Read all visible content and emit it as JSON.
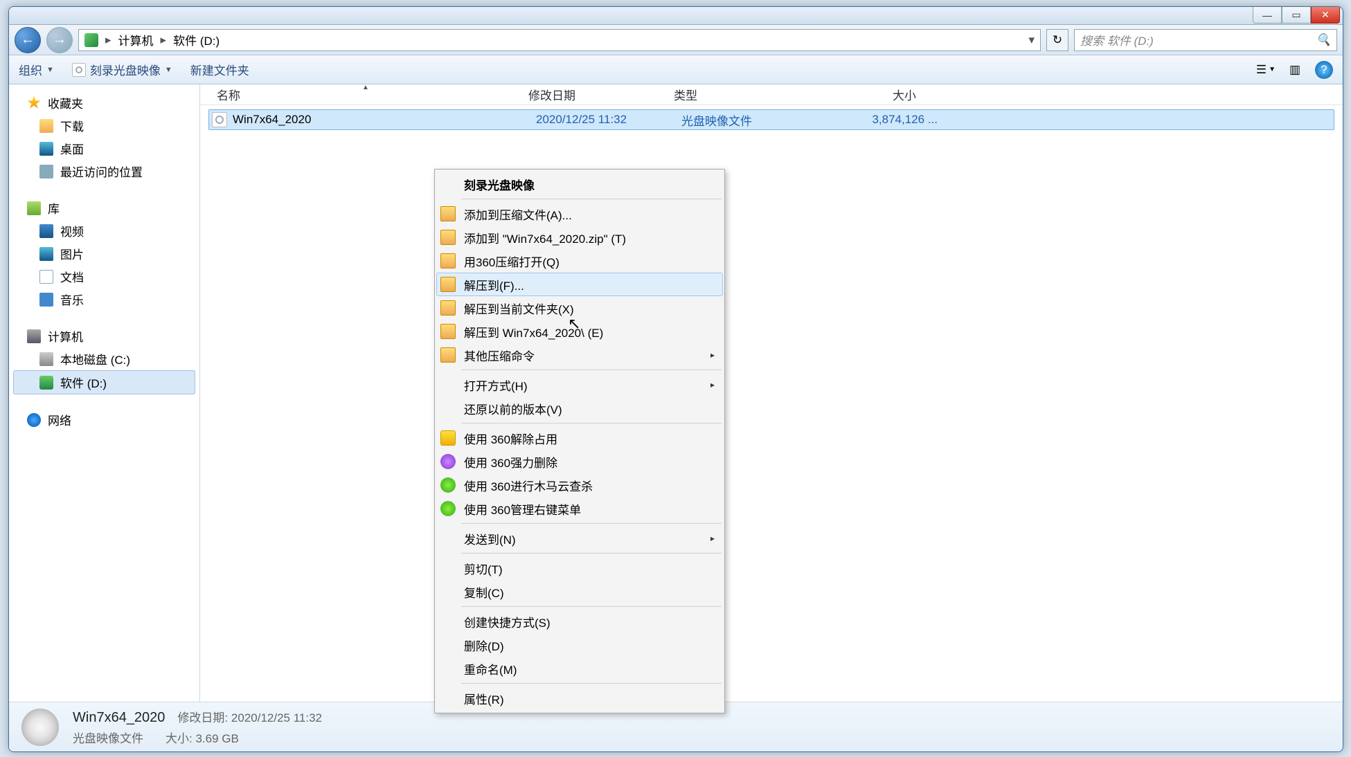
{
  "titlebar": {
    "min": "—",
    "max": "▭",
    "close": "✕"
  },
  "nav": {
    "back_arrow": "←",
    "fwd_arrow": "→",
    "crumb_computer": "计算机",
    "crumb_sep": "▸",
    "crumb_drive": "软件 (D:)",
    "refresh_glyph": "↻",
    "search_placeholder": "搜索 软件 (D:)",
    "search_glyph": "🔍"
  },
  "toolbar": {
    "organize": "组织",
    "burn": "刻录光盘映像",
    "newfolder": "新建文件夹",
    "view_glyph": "☰",
    "preview_glyph": "▥",
    "help_glyph": "?"
  },
  "sidebar": {
    "fav_header": "收藏夹",
    "fav_downloads": "下载",
    "fav_desktop": "桌面",
    "fav_recent": "最近访问的位置",
    "lib_header": "库",
    "lib_video": "视频",
    "lib_pictures": "图片",
    "lib_docs": "文档",
    "lib_music": "音乐",
    "comp_header": "计算机",
    "comp_c": "本地磁盘 (C:)",
    "comp_d": "软件 (D:)",
    "net_header": "网络"
  },
  "columns": {
    "name": "名称",
    "date": "修改日期",
    "type": "类型",
    "size": "大小"
  },
  "file": {
    "name": "Win7x64_2020",
    "date": "2020/12/25 11:32",
    "type": "光盘映像文件",
    "size": "3,874,126 ..."
  },
  "contextmenu": {
    "burn": "刻录光盘映像",
    "add_archive": "添加到压缩文件(A)...",
    "add_zip": "添加到 \"Win7x64_2020.zip\" (T)",
    "open_360zip": "用360压缩打开(Q)",
    "extract_to": "解压到(F)...",
    "extract_here": "解压到当前文件夹(X)",
    "extract_folder": "解压到 Win7x64_2020\\ (E)",
    "other_zip": "其他压缩命令",
    "open_with": "打开方式(H)",
    "restore_prev": "还原以前的版本(V)",
    "unlock_360": "使用 360解除占用",
    "forcedel_360": "使用 360强力删除",
    "trojan_360": "使用 360进行木马云查杀",
    "rightmenu_360": "使用 360管理右键菜单",
    "send_to": "发送到(N)",
    "cut": "剪切(T)",
    "copy": "复制(C)",
    "shortcut": "创建快捷方式(S)",
    "delete": "删除(D)",
    "rename": "重命名(M)",
    "properties": "属性(R)",
    "arrow": "▸"
  },
  "status": {
    "name": "Win7x64_2020",
    "type": "光盘映像文件",
    "date_label": "修改日期:",
    "date_val": "2020/12/25 11:32",
    "size_label": "大小:",
    "size_val": "3.69 GB"
  }
}
